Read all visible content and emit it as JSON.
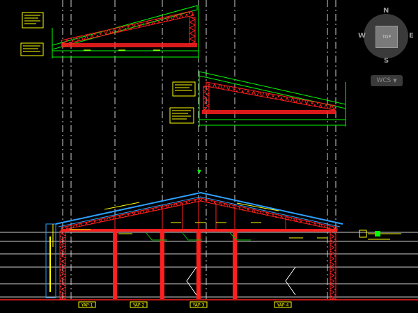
{
  "viewcube": {
    "face_label": "TOP",
    "north": "N",
    "south": "S",
    "east": "E",
    "west": "W"
  },
  "wcs_menu": {
    "label": "WCS",
    "arrow_icon": "chevron-down-icon"
  },
  "drawing": {
    "bay_tags": [
      "YAP-1",
      "YAP-2",
      "YAP-3",
      "YAP-4"
    ],
    "colors": {
      "truss": "#ff1f1f",
      "roof": "#2ea0ff",
      "dimension": "#00ff00",
      "text": "#ffff00",
      "grid": "#ffffff",
      "leader": "#00c000"
    }
  }
}
